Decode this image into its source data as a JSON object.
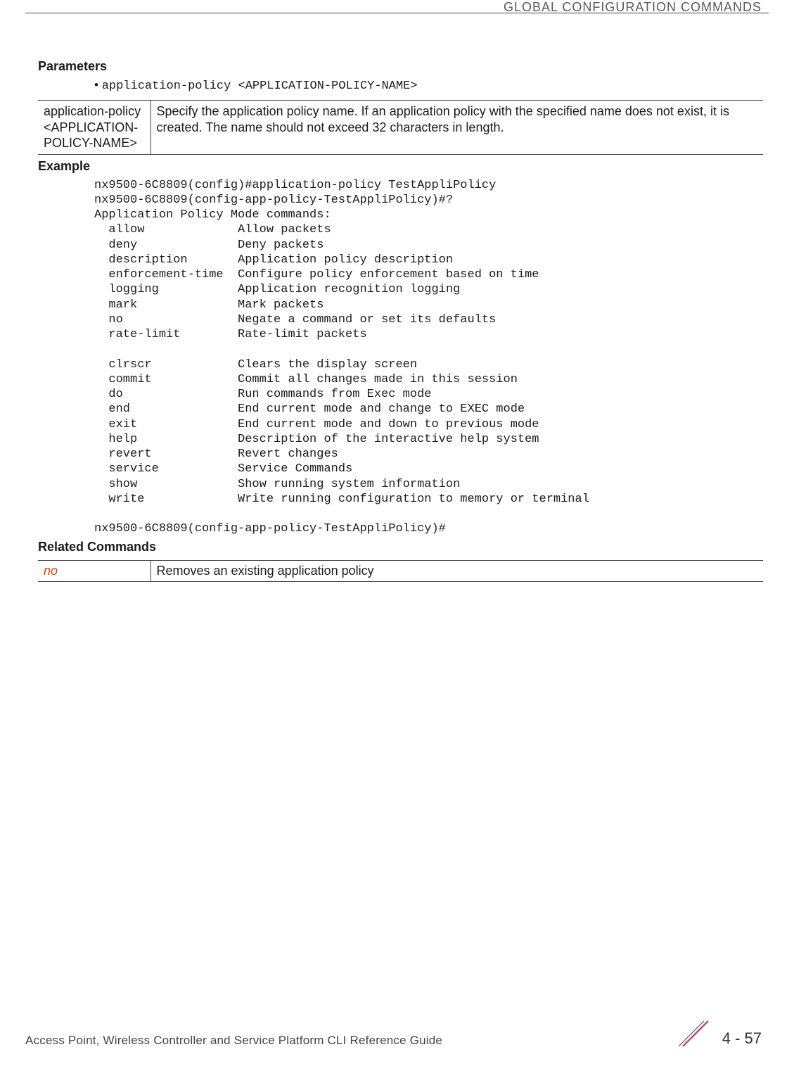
{
  "header": {
    "running_title": "GLOBAL CONFIGURATION COMMANDS"
  },
  "sections": {
    "parameters_h": "Parameters",
    "syntax_line": "application-policy <APPLICATION-POLICY-NAME>",
    "param_table": {
      "left": "application-policy <APPLICATION-POLICY-NAME>",
      "right": "Specify the application policy name. If an application policy with the specified name does not exist, it is created. The name should not exceed 32 characters in length."
    },
    "example_h": "Example",
    "example_block": "nx9500-6C8809(config)#application-policy TestAppliPolicy\nnx9500-6C8809(config-app-policy-TestAppliPolicy)#?\nApplication Policy Mode commands:\n  allow             Allow packets\n  deny              Deny packets\n  description       Application policy description\n  enforcement-time  Configure policy enforcement based on time\n  logging           Application recognition logging\n  mark              Mark packets\n  no                Negate a command or set its defaults\n  rate-limit        Rate-limit packets\n\n  clrscr            Clears the display screen\n  commit            Commit all changes made in this session\n  do                Run commands from Exec mode\n  end               End current mode and change to EXEC mode\n  exit              End current mode and down to previous mode\n  help              Description of the interactive help system\n  revert            Revert changes\n  service           Service Commands\n  show              Show running system information\n  write             Write running configuration to memory or terminal\n\nnx9500-6C8809(config-app-policy-TestAppliPolicy)#",
    "related_h": "Related Commands",
    "related_table": {
      "left": "no",
      "right": "Removes an existing application policy"
    }
  },
  "footer": {
    "doc_title": "Access Point, Wireless Controller and Service Platform CLI Reference Guide",
    "page_number": "4 - 57"
  }
}
